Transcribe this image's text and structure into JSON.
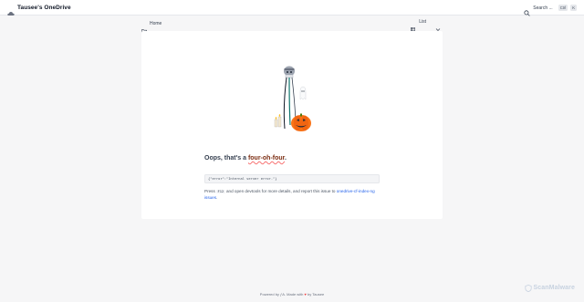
{
  "header": {
    "title": "Tausee's OneDrive",
    "brand_icon": "onedrive-cloud-icon",
    "search_label": "Search ...",
    "shortcut_keys": [
      "Ctrl",
      "K"
    ]
  },
  "toolbar": {
    "breadcrumb": "Home",
    "view_label": "List"
  },
  "error": {
    "heading_prefix": "Oops, that's a ",
    "heading_accent": "four-oh-four",
    "heading_suffix": ".",
    "code": "{\"error\":\"Internal server error.\"}",
    "help_press": "Press",
    "help_key": "F12",
    "help_middle": "and open devtools for more details, and report this issue to",
    "help_link": "onedrive-cf-index-ng issues",
    "help_end": "."
  },
  "footer": {
    "prefix": "Powered by",
    "product": "ƒA",
    "made": ". Made with",
    "heart": "♥",
    "by": "by Tausee"
  },
  "watermark": {
    "text": "ScanMalware"
  },
  "colors": {
    "accent_link": "#2563eb",
    "pumpkin": "#f97316",
    "page_bg": "#f6f6f7"
  }
}
